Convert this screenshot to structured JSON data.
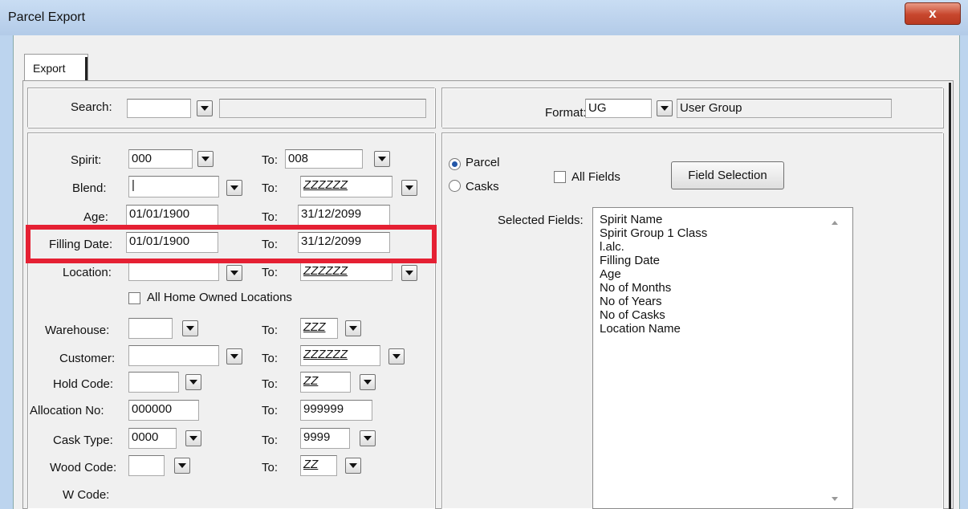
{
  "window": {
    "title": "Parcel Export",
    "close_label": "x"
  },
  "tabs": [
    {
      "label": "Export",
      "active": true
    }
  ],
  "search": {
    "label": "Search:",
    "value": "",
    "description": ""
  },
  "format": {
    "label": "Format:",
    "code": "UG",
    "description": "User Group"
  },
  "filters": {
    "to_label": "To:",
    "spirit": {
      "label": "Spirit:",
      "from": "000",
      "to": "008"
    },
    "blend": {
      "label": "Blend:",
      "from": "|",
      "to": "ZZZZZZ"
    },
    "age": {
      "label": "Age:",
      "from": "01/01/1900",
      "to": "31/12/2099"
    },
    "filling_date": {
      "label": "Filling Date:",
      "from": "01/01/1900",
      "to": "31/12/2099"
    },
    "location": {
      "label": "Location:",
      "from": "",
      "to": "ZZZZZZ"
    },
    "all_home_owned": {
      "label": "All Home Owned Locations",
      "checked": false
    },
    "warehouse": {
      "label": "Warehouse:",
      "from": "",
      "to": "ZZZ"
    },
    "customer": {
      "label": "Customer:",
      "from": "",
      "to": "ZZZZZZ"
    },
    "hold_code": {
      "label": "Hold Code:",
      "from": "",
      "to": "ZZ"
    },
    "allocation_no": {
      "label": "Allocation No:",
      "from": "000000",
      "to": "999999"
    },
    "cask_type": {
      "label": "Cask Type:",
      "from": "0000",
      "to": "9999"
    },
    "wood_code": {
      "label": "Wood Code:",
      "from": "",
      "to": "ZZ"
    },
    "w_code": {
      "label": "W Code:"
    }
  },
  "export_type": {
    "options": [
      {
        "label": "Parcel",
        "selected": true
      },
      {
        "label": "Casks",
        "selected": false
      }
    ],
    "all_fields": {
      "label": "All Fields",
      "checked": false
    },
    "field_selection_label": "Field Selection"
  },
  "selected_fields": {
    "label": "Selected Fields:",
    "items": [
      "Spirit Name",
      "Spirit Group 1 Class",
      "l.alc.",
      "Filling Date",
      "Age",
      "No of Months",
      "No of Years",
      "No of Casks",
      "Location Name"
    ]
  },
  "colors": {
    "highlight": "#e52033",
    "radio_dot": "#2357a8",
    "close_button": "#c7462d"
  }
}
